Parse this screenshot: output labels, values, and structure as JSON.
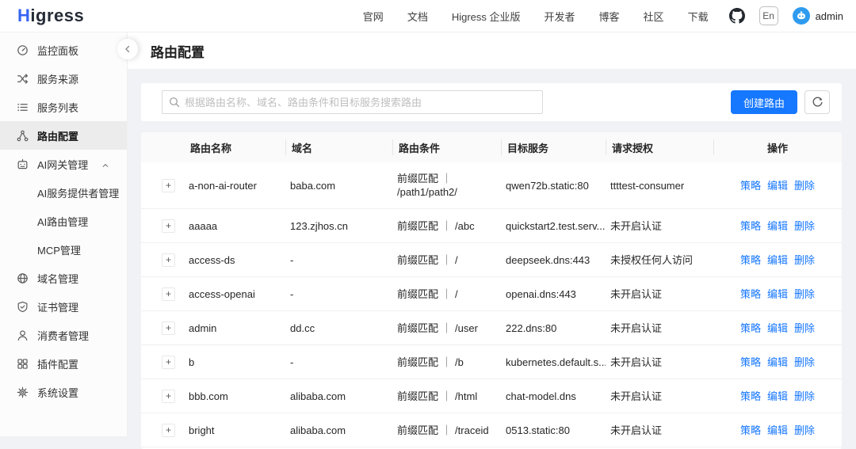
{
  "brand": {
    "logo_accent": "H",
    "logo_text": "igress"
  },
  "topnav": {
    "links": [
      "官网",
      "文档",
      "Higress 企业版",
      "开发者",
      "博客",
      "社区",
      "下载"
    ],
    "github_icon": "github-icon",
    "language": "En",
    "username": "admin"
  },
  "sidebar": {
    "items": [
      {
        "label": "监控面板",
        "icon": "dashboard-icon",
        "active": false
      },
      {
        "label": "服务来源",
        "icon": "service-source-icon",
        "active": false
      },
      {
        "label": "服务列表",
        "icon": "service-list-icon",
        "active": false
      },
      {
        "label": "路由配置",
        "icon": "route-icon",
        "active": true
      },
      {
        "label": "AI网关管理",
        "icon": "ai-gateway-icon",
        "active": false,
        "expanded": true,
        "children": [
          "AI服务提供者管理",
          "AI路由管理",
          "MCP管理"
        ]
      },
      {
        "label": "域名管理",
        "icon": "domain-icon",
        "active": false
      },
      {
        "label": "证书管理",
        "icon": "certificate-icon",
        "active": false
      },
      {
        "label": "消费者管理",
        "icon": "consumer-icon",
        "active": false
      },
      {
        "label": "插件配置",
        "icon": "plugin-icon",
        "active": false
      },
      {
        "label": "系统设置",
        "icon": "settings-icon",
        "active": false
      }
    ]
  },
  "page": {
    "title": "路由配置"
  },
  "toolbar": {
    "search_placeholder": "根据路由名称、域名、路由条件和目标服务搜索路由",
    "create_button": "创建路由",
    "refresh_icon": "refresh-icon",
    "search_icon": "search-icon"
  },
  "table": {
    "columns": [
      "路由名称",
      "域名",
      "路由条件",
      "目标服务",
      "请求授权",
      "操作"
    ],
    "action_labels": [
      "策略",
      "编辑",
      "删除"
    ],
    "condition_separator": "｜",
    "rows": [
      {
        "name": "a-non-ai-router",
        "domain": "baba.com",
        "match": "前缀匹配",
        "path": "/path1/path2/",
        "target": "qwen72b.static:80",
        "auth": "ttttest-consumer"
      },
      {
        "name": "aaaaa",
        "domain": "123.zjhos.cn",
        "match": "前缀匹配",
        "path": "/abc",
        "target": "quickstart2.test.serv...",
        "auth": "未开启认证"
      },
      {
        "name": "access-ds",
        "domain": "-",
        "match": "前缀匹配",
        "path": "/",
        "target": "deepseek.dns:443",
        "auth": "未授权任何人访问"
      },
      {
        "name": "access-openai",
        "domain": "-",
        "match": "前缀匹配",
        "path": "/",
        "target": "openai.dns:443",
        "auth": "未开启认证"
      },
      {
        "name": "admin",
        "domain": "dd.cc",
        "match": "前缀匹配",
        "path": "/user",
        "target": "222.dns:80",
        "auth": "未开启认证"
      },
      {
        "name": "b",
        "domain": "-",
        "match": "前缀匹配",
        "path": "/b",
        "target": "kubernetes.default.s...",
        "auth": "未开启认证"
      },
      {
        "name": "bbb.com",
        "domain": "alibaba.com",
        "match": "前缀匹配",
        "path": "/html",
        "target": "chat-model.dns",
        "auth": "未开启认证"
      },
      {
        "name": "bright",
        "domain": "alibaba.com",
        "match": "前缀匹配",
        "path": "/traceid",
        "target": "0513.static:80",
        "auth": "未开启认证"
      }
    ]
  },
  "colors": {
    "accent": "#1677ff",
    "logo_accent": "#3566f2",
    "content_bg": "#f0f2f5"
  }
}
